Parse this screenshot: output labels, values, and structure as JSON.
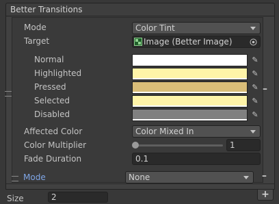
{
  "header": {
    "title": "Better Transitions"
  },
  "transition": {
    "mode_label": "Mode",
    "mode_value": "Color Tint",
    "target_label": "Target",
    "target_value": "Image (Better Image)",
    "states": [
      {
        "label": "Normal",
        "color": "#ffffff"
      },
      {
        "label": "Highlighted",
        "color": "#fff4a8"
      },
      {
        "label": "Pressed",
        "color": "#d9bd78"
      },
      {
        "label": "Selected",
        "color": "#fff4a8"
      },
      {
        "label": "Disabled",
        "color": "#808080"
      }
    ],
    "affected_label": "Affected Color",
    "affected_value": "Color Mixed In",
    "multiplier_label": "Color Multiplier",
    "multiplier_value": "1",
    "multiplier_slider_fraction": 0.0,
    "fade_label": "Fade Duration",
    "fade_value": "0.1"
  },
  "second": {
    "mode_label": "Mode",
    "mode_value": "None"
  },
  "footer": {
    "size_label": "Size",
    "size_value": "2",
    "add_label": "+"
  },
  "colors": {
    "accent_label": "#7fa6e6"
  }
}
